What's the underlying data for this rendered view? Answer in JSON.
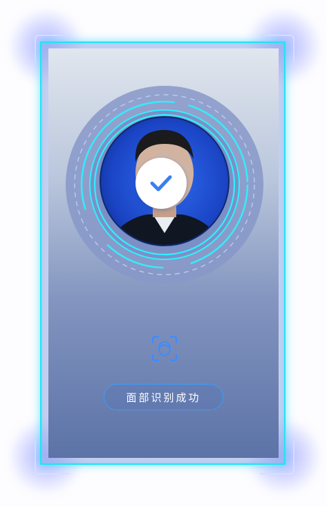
{
  "status": {
    "label": "面部识别成功",
    "state": "success"
  },
  "icons": {
    "check": "checkmark-icon",
    "scan": "face-scan-icon"
  },
  "colors": {
    "frame_cyan": "#22e2f4",
    "ring_cyan": "#2ff0ff",
    "check_blue": "#3a7ff0",
    "button_border": "#3b9dfd",
    "photo_background": "#1d4fcf"
  }
}
